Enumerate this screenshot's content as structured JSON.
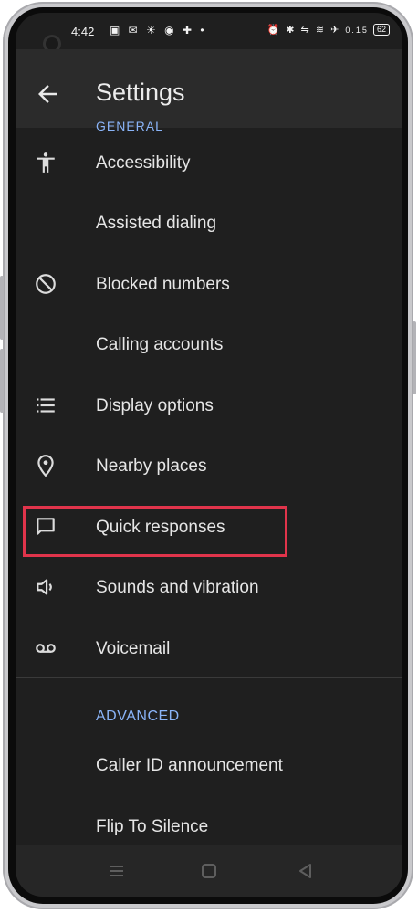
{
  "status_bar": {
    "time": "4:42",
    "left_icons": "▣ ✉ ☀ ◉ ✚ •",
    "right_icons": "⏰ ✱ ⇋ ≋ ✈",
    "speed": "0.15",
    "battery": "62"
  },
  "toolbar": {
    "title": "Settings",
    "back_icon": "arrow-left"
  },
  "list": {
    "section_general": "GENERAL",
    "items": [
      {
        "label": "Accessibility",
        "icon": "accessibility-icon"
      },
      {
        "label": "Assisted dialing",
        "icon": ""
      },
      {
        "label": "Blocked numbers",
        "icon": "block-icon"
      },
      {
        "label": "Calling accounts",
        "icon": ""
      },
      {
        "label": "Display options",
        "icon": "list-icon"
      },
      {
        "label": "Nearby places",
        "icon": "location-pin-icon"
      },
      {
        "label": "Quick responses",
        "icon": "chat-bubble-icon"
      },
      {
        "label": "Sounds and vibration",
        "icon": "speaker-icon"
      },
      {
        "label": "Voicemail",
        "icon": "voicemail-icon"
      }
    ],
    "section_advanced": "ADVANCED",
    "advanced_items": [
      {
        "label": "Caller ID announcement"
      },
      {
        "label": "Flip To Silence"
      }
    ]
  },
  "highlight": {
    "color": "#e0344b",
    "target": "Quick responses"
  },
  "navbar": {
    "recents_icon": "menu-icon",
    "home_icon": "square-icon",
    "back_icon": "triangle-back-icon"
  },
  "colors": {
    "background": "#1f1f1f",
    "toolbar": "#2b2b2b",
    "accent": "#8ab4f8"
  }
}
